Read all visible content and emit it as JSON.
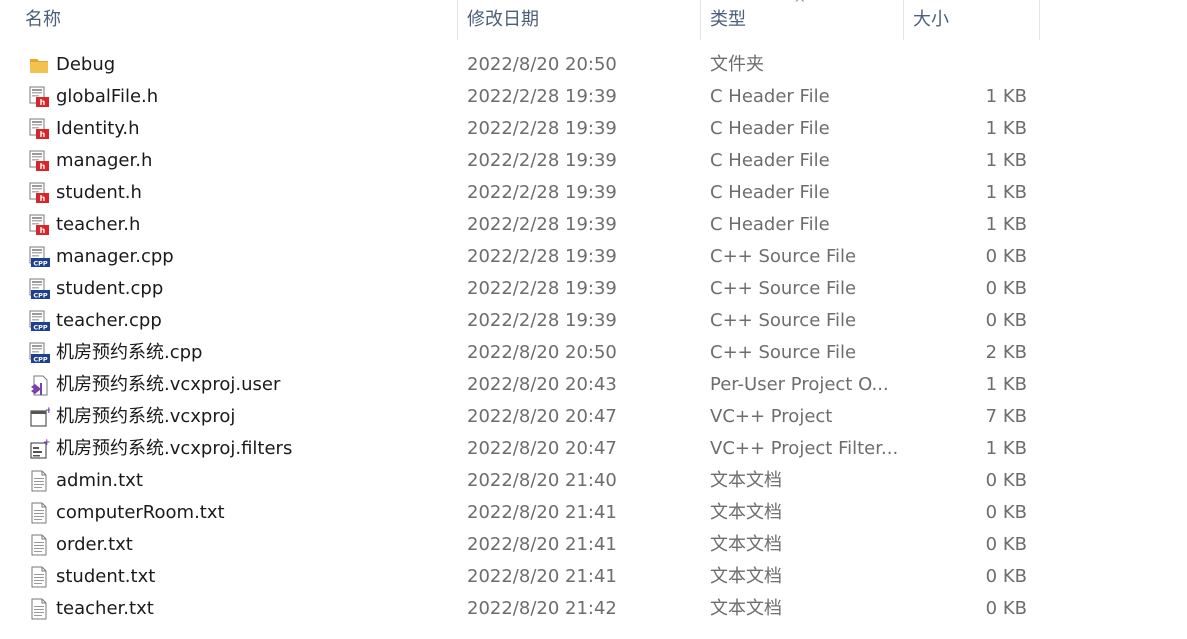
{
  "columns": {
    "name": "名称",
    "date": "修改日期",
    "type": "类型",
    "size": "大小"
  },
  "sort_indicator": "^",
  "files": [
    {
      "name": "Debug",
      "date": "2022/8/20 20:50",
      "type": "文件夹",
      "size": "",
      "icon": "folder-icon"
    },
    {
      "name": "globalFile.h",
      "date": "2022/2/28 19:39",
      "type": "C Header File",
      "size": "1 KB",
      "icon": "c-header-file-icon"
    },
    {
      "name": "Identity.h",
      "date": "2022/2/28 19:39",
      "type": "C Header File",
      "size": "1 KB",
      "icon": "c-header-file-icon"
    },
    {
      "name": "manager.h",
      "date": "2022/2/28 19:39",
      "type": "C Header File",
      "size": "1 KB",
      "icon": "c-header-file-icon"
    },
    {
      "name": "student.h",
      "date": "2022/2/28 19:39",
      "type": "C Header File",
      "size": "1 KB",
      "icon": "c-header-file-icon"
    },
    {
      "name": "teacher.h",
      "date": "2022/2/28 19:39",
      "type": "C Header File",
      "size": "1 KB",
      "icon": "c-header-file-icon"
    },
    {
      "name": "manager.cpp",
      "date": "2022/2/28 19:39",
      "type": "C++ Source File",
      "size": "0 KB",
      "icon": "cpp-source-file-icon"
    },
    {
      "name": "student.cpp",
      "date": "2022/2/28 19:39",
      "type": "C++ Source File",
      "size": "0 KB",
      "icon": "cpp-source-file-icon"
    },
    {
      "name": "teacher.cpp",
      "date": "2022/2/28 19:39",
      "type": "C++ Source File",
      "size": "0 KB",
      "icon": "cpp-source-file-icon"
    },
    {
      "name": "机房预约系统.cpp",
      "date": "2022/8/20 20:50",
      "type": "C++ Source File",
      "size": "2 KB",
      "icon": "cpp-source-file-icon"
    },
    {
      "name": "机房预约系统.vcxproj.user",
      "date": "2022/8/20 20:43",
      "type": "Per-User Project O...",
      "size": "1 KB",
      "icon": "vs-user-file-icon"
    },
    {
      "name": "机房预约系统.vcxproj",
      "date": "2022/8/20 20:47",
      "type": "VC++ Project",
      "size": "7 KB",
      "icon": "vcxproj-file-icon"
    },
    {
      "name": "机房预约系统.vcxproj.filters",
      "date": "2022/8/20 20:47",
      "type": "VC++ Project Filter...",
      "size": "1 KB",
      "icon": "vcxproj-filters-file-icon"
    },
    {
      "name": "admin.txt",
      "date": "2022/8/20 21:40",
      "type": "文本文档",
      "size": "0 KB",
      "icon": "text-file-icon"
    },
    {
      "name": "computerRoom.txt",
      "date": "2022/8/20 21:41",
      "type": "文本文档",
      "size": "0 KB",
      "icon": "text-file-icon"
    },
    {
      "name": "order.txt",
      "date": "2022/8/20 21:41",
      "type": "文本文档",
      "size": "0 KB",
      "icon": "text-file-icon"
    },
    {
      "name": "student.txt",
      "date": "2022/8/20 21:41",
      "type": "文本文档",
      "size": "0 KB",
      "icon": "text-file-icon"
    },
    {
      "name": "teacher.txt",
      "date": "2022/8/20 21:42",
      "type": "文本文档",
      "size": "0 KB",
      "icon": "text-file-icon"
    }
  ],
  "colors": {
    "header_text": "#4c607a",
    "name_text": "#1a1a1a",
    "detail_text": "#6d6d6d",
    "folder": "#f3c24e",
    "header_badge": "#d9262a",
    "cpp_badge": "#1f3f8f",
    "vs_purple": "#7b3fb0"
  }
}
